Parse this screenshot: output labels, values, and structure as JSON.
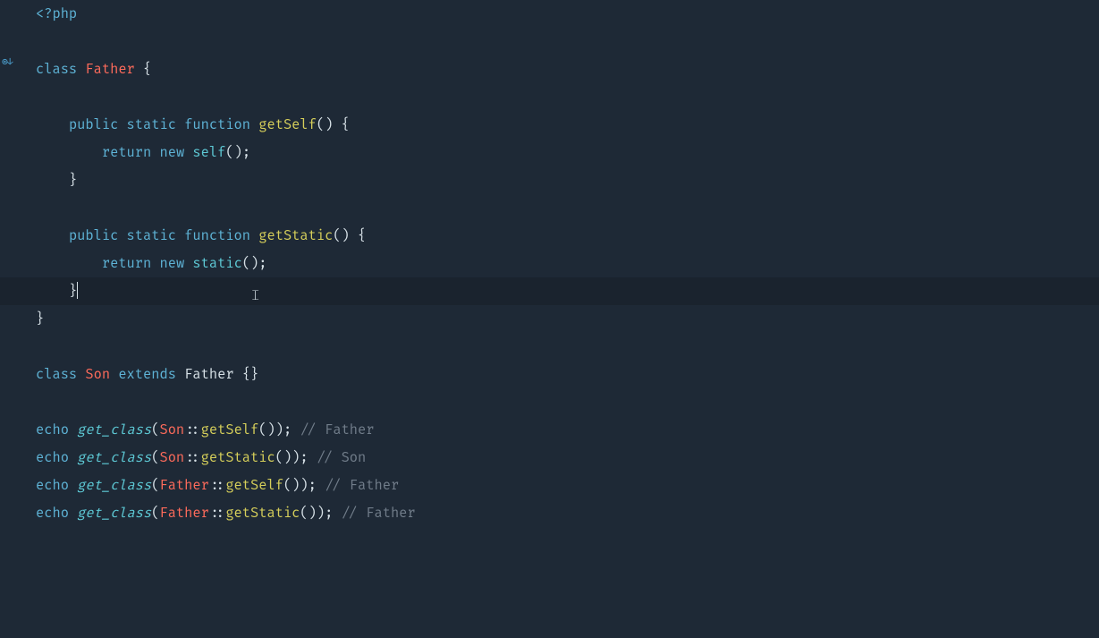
{
  "gutter": {
    "mark": "◎↓",
    "mark_line": 3
  },
  "ibeam_glyph": "𝙸",
  "code": {
    "l1": {
      "open": "<?php"
    },
    "l3": {
      "kw_class": "class ",
      "name": "Father ",
      "brace": "{"
    },
    "l5": {
      "mods": "public static ",
      "fn_kw": "function ",
      "fn": "getSelf",
      "after": "() {"
    },
    "l6": {
      "ret": "return ",
      "new": "new ",
      "type": "self",
      "after": "();"
    },
    "l7": {
      "brace": "}"
    },
    "l9": {
      "mods": "public static ",
      "fn_kw": "function ",
      "fn": "getStatic",
      "after": "() {"
    },
    "l10": {
      "ret": "return ",
      "new": "new ",
      "type": "static",
      "after": "();"
    },
    "l11": {
      "brace": "}"
    },
    "l12": {
      "brace": "}"
    },
    "l14": {
      "kw_class": "class ",
      "name": "Son ",
      "ext": "extends ",
      "parent": "Father ",
      "braces": "{}"
    },
    "l16": {
      "echo": "echo ",
      "gc": "get_class",
      "p1": "(",
      "cls": "Son",
      "sep": "::",
      "m": "getSelf",
      "p2": "()); ",
      "c": "// Father"
    },
    "l17": {
      "echo": "echo ",
      "gc": "get_class",
      "p1": "(",
      "cls": "Son",
      "sep": "::",
      "m": "getStatic",
      "p2": "()); ",
      "c": "// Son"
    },
    "l18": {
      "echo": "echo ",
      "gc": "get_class",
      "p1": "(",
      "cls": "Father",
      "sep": "::",
      "m": "getSelf",
      "p2": "()); ",
      "c": "// Father"
    },
    "l19": {
      "echo": "echo ",
      "gc": "get_class",
      "p1": "(",
      "cls": "Father",
      "sep": "::",
      "m": "getStatic",
      "p2": "()); ",
      "c": "// Father"
    }
  }
}
